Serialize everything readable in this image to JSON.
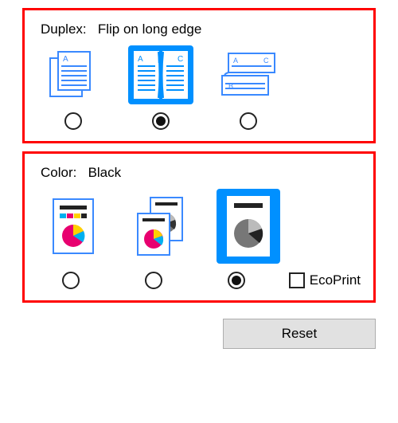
{
  "duplex": {
    "label": "Duplex:",
    "value": "Flip on long edge",
    "selected_index": 1,
    "options": [
      {
        "id": "simplex",
        "desc": "Off (simplex)"
      },
      {
        "id": "long-edge",
        "desc": "Flip on long edge"
      },
      {
        "id": "short-edge",
        "desc": "Flip on short edge"
      }
    ]
  },
  "color": {
    "label": "Color:",
    "value": "Black",
    "selected_index": 2,
    "options": [
      {
        "id": "full-color",
        "desc": "Full color"
      },
      {
        "id": "auto-color",
        "desc": "Auto color"
      },
      {
        "id": "black",
        "desc": "Black"
      }
    ]
  },
  "ecoprint": {
    "label": "EcoPrint",
    "checked": false
  },
  "buttons": {
    "reset": "Reset"
  },
  "colors": {
    "accent": "#0090ff",
    "highlight_border": "#ff0000"
  }
}
